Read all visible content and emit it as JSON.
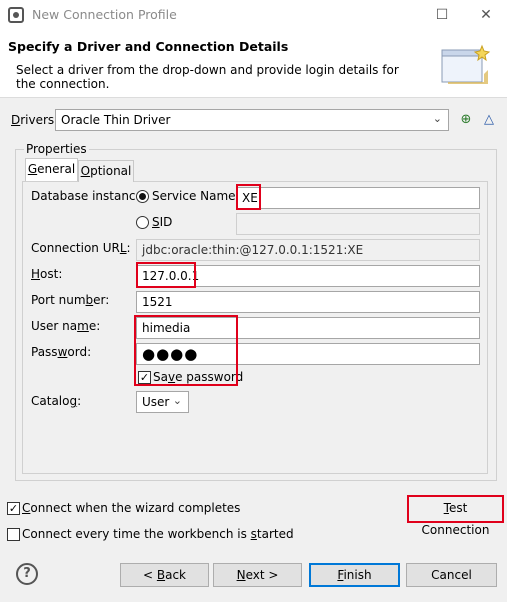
{
  "window": {
    "title": "New Connection Profile"
  },
  "header": {
    "title": "Specify a Driver and Connection Details",
    "description": "Select a driver from the drop-down and provide login details for the connection."
  },
  "drivers": {
    "label_pre": "",
    "label_acc": "D",
    "label_post": "rivers:",
    "selected": "Oracle Thin Driver"
  },
  "properties": {
    "legend": "Properties",
    "tabs": [
      {
        "label": "General",
        "acc": "G",
        "rest": "eneral"
      },
      {
        "label": "Optional",
        "acc": "O",
        "rest": "ptional"
      }
    ],
    "database_instance": {
      "label": "Database instance:",
      "service_name_label": "Service Name",
      "service_name_value": "XE",
      "sid_label_acc": "S",
      "sid_label_rest": "ID",
      "sid_value": ""
    },
    "connection_url": {
      "label_pre": "Connection UR",
      "label_acc": "L",
      "label_post": ":",
      "value": "jdbc:oracle:thin:@127.0.0.1:1521:XE"
    },
    "host": {
      "label_acc": "H",
      "label_rest": "ost:",
      "value": "127.0.0.1"
    },
    "port": {
      "label_pre": "Port num",
      "label_acc": "b",
      "label_post": "er:",
      "value": "1521"
    },
    "user_name": {
      "label_pre": "User na",
      "label_acc": "m",
      "label_post": "e:",
      "value": "himedia"
    },
    "password": {
      "label_pre": "Pass",
      "label_acc": "w",
      "label_post": "ord:",
      "value": "●●●●"
    },
    "save_password": {
      "acc": "v",
      "pre": "Sa",
      "post": "e password",
      "checked": true
    },
    "catalog": {
      "label_pre": "Catalo",
      "label_acc": "g",
      "label_post": ":",
      "value": "User"
    }
  },
  "options": {
    "connect_on_finish": {
      "acc": "C",
      "rest": "onnect when the wizard completes",
      "checked": true
    },
    "connect_every_time": {
      "pre": "Connect every time the workbench is ",
      "acc": "s",
      "post": "tarted",
      "checked": false
    }
  },
  "buttons": {
    "test_connection": {
      "acc": "T",
      "rest": "est Connection"
    },
    "back": {
      "pre": "< ",
      "acc": "B",
      "post": "ack"
    },
    "next": {
      "acc": "N",
      "post": "ext >"
    },
    "finish": {
      "acc": "F",
      "post": "inish"
    },
    "cancel": "Cancel"
  },
  "colors": {
    "highlight": "#e0001b",
    "accent": "#0078d7"
  },
  "icons": [
    "app-icon",
    "minimize-icon",
    "maximize-icon",
    "close-icon",
    "wizard-banner-icon",
    "new-driver-icon",
    "edit-driver-icon",
    "chevron-down-icon",
    "help-icon"
  ]
}
